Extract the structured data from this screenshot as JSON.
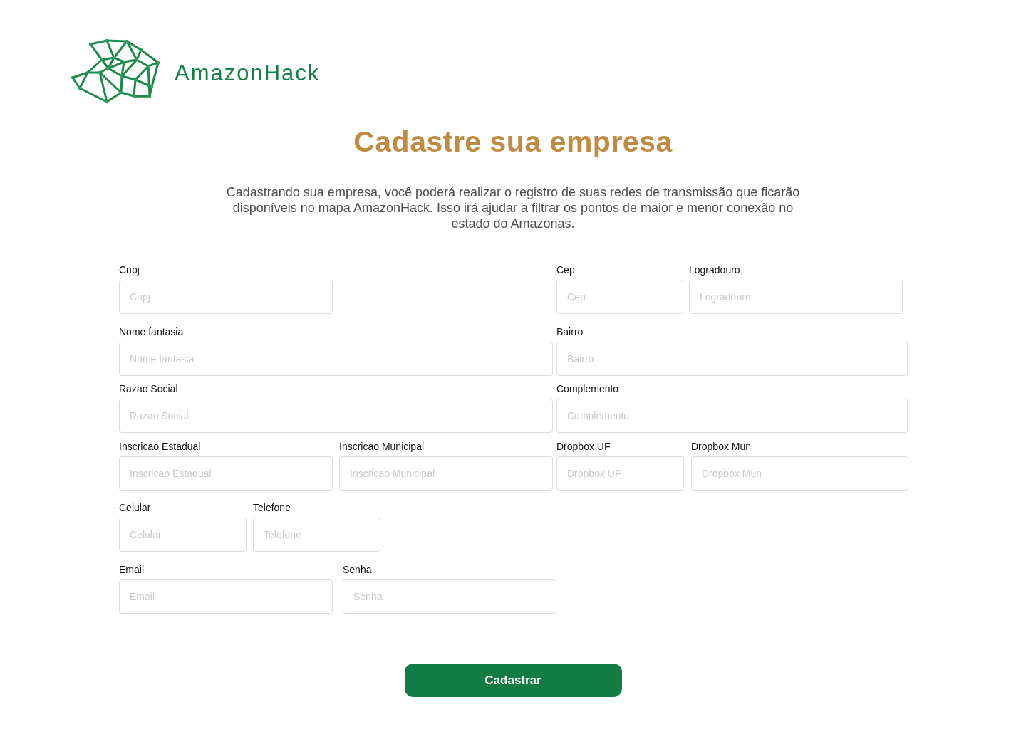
{
  "brand": {
    "name": "AmazonHack"
  },
  "title": "Cadastre sua empresa",
  "description": "Cadastrando sua empresa, você poderá realizar o registro de suas redes de transmissão que ficarão disponíveis no mapa AmazonHack.  Isso irá ajudar a filtrar os pontos de maior e menor conexão no estado do Amazonas.",
  "form_rows": [
    [
      {
        "label": "Cnpj",
        "placeholder": "Cnpj"
      },
      {
        "label": "Cep",
        "placeholder": "Cep"
      },
      {
        "label": "Logradouro",
        "placeholder": "Logradouro"
      }
    ],
    [
      {
        "label": "Nome fantasia",
        "placeholder": "Nome fantasia"
      },
      {
        "label": "Bairro",
        "placeholder": "Bairro"
      }
    ],
    [
      {
        "label": "Razao Social",
        "placeholder": "Razao Social"
      },
      {
        "label": "Complemento",
        "placeholder": "Complemento"
      }
    ],
    [
      {
        "label": "Inscricao Estadual",
        "placeholder": "Inscricao Estadual"
      },
      {
        "label": "Inscricao Municipal",
        "placeholder": "Inscricao Municipal"
      },
      {
        "label": "Dropbox UF",
        "placeholder": "Dropbox UF"
      },
      {
        "label": "Dropbox Mun",
        "placeholder": "Dropbox Mun"
      }
    ],
    [
      {
        "label": "Celular",
        "placeholder": "Celular"
      },
      {
        "label": "Telefone",
        "placeholder": "Telefone"
      }
    ],
    [
      {
        "label": "Email",
        "placeholder": "Email"
      },
      {
        "label": "Senha",
        "placeholder": "Senha"
      }
    ]
  ],
  "submit_button": "Cadastrar"
}
